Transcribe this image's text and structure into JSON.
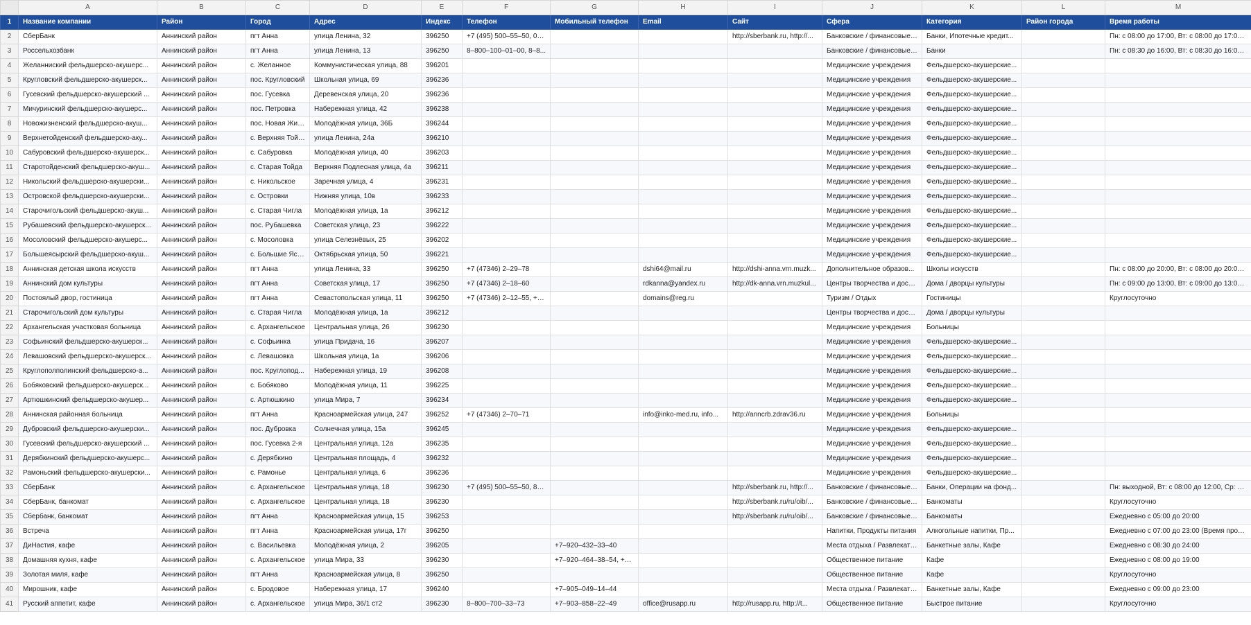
{
  "columns": [
    "A",
    "B",
    "C",
    "D",
    "E",
    "F",
    "G",
    "H",
    "I",
    "J",
    "K",
    "L",
    "M"
  ],
  "header": {
    "row_number": "1",
    "cells": [
      "Название компании",
      "Район",
      "Город",
      "Адрес",
      "Индекс",
      "Телефон",
      "Мобильный телефон",
      "Email",
      "Сайт",
      "Сфера",
      "Категория",
      "Район города",
      "Время работы"
    ]
  },
  "rows": [
    {
      "n": "2",
      "cells": [
        "СберБанк",
        "Аннинский район",
        "пгт Анна",
        "улица Ленина, 32",
        "396250",
        "+7 (495) 500–55–50, 03...",
        "",
        "",
        "http://sberbank.ru, http://...",
        "Банковские / финансовые ...",
        "Банки, Ипотечные кредит...",
        "",
        "Пн: с 08:00 до 17:00, Вт: с 08:00 до 17:00, С..."
      ]
    },
    {
      "n": "3",
      "cells": [
        "Россельхозбанк",
        "Аннинский район",
        "пгт Анна",
        "улица Ленина, 13",
        "396250",
        "8–800–100–01–00, 8–8...",
        "",
        "",
        "",
        "Банковские / финансовые ...",
        "Банки",
        "",
        "Пн: с 08:30 до 16:00, Вт: с 08:30 до 16:00, С..."
      ]
    },
    {
      "n": "4",
      "cells": [
        "Желанниский фельдшерско-акушерс...",
        "Аннинский район",
        "с. Желанное",
        "Коммунистическая улица, 88",
        "396201",
        "",
        "",
        "",
        "",
        "Медицинские учреждения",
        "Фельдшерско-акушерские...",
        "",
        ""
      ]
    },
    {
      "n": "5",
      "cells": [
        "Кругловский фельдшерско-акушерск...",
        "Аннинский район",
        "пос. Кругловский",
        "Школьная улица, 69",
        "396236",
        "",
        "",
        "",
        "",
        "Медицинские учреждения",
        "Фельдшерско-акушерские...",
        "",
        ""
      ]
    },
    {
      "n": "6",
      "cells": [
        "Гусевский фельдшерско-акушерский ...",
        "Аннинский район",
        "пос. Гусевка",
        "Деревенская улица, 20",
        "396236",
        "",
        "",
        "",
        "",
        "Медицинские учреждения",
        "Фельдшерско-акушерские...",
        "",
        ""
      ]
    },
    {
      "n": "7",
      "cells": [
        "Мичуринский фельдшерско-акушерс...",
        "Аннинский район",
        "пос. Петровка",
        "Набережная улица, 42",
        "396238",
        "",
        "",
        "",
        "",
        "Медицинские учреждения",
        "Фельдшерско-акушерские...",
        "",
        ""
      ]
    },
    {
      "n": "8",
      "cells": [
        "Новожизненский фельдшерско-акуш...",
        "Аннинский район",
        "пос. Новая Жиз...",
        "Молодёжная улица, 36Б",
        "396244",
        "",
        "",
        "",
        "",
        "Медицинские учреждения",
        "Фельдшерско-акушерские...",
        "",
        ""
      ]
    },
    {
      "n": "9",
      "cells": [
        "Верхнетойденский фельдшерско-аку...",
        "Аннинский район",
        "с. Верхняя Тойда",
        "улица Ленина, 24а",
        "396210",
        "",
        "",
        "",
        "",
        "Медицинские учреждения",
        "Фельдшерско-акушерские...",
        "",
        ""
      ]
    },
    {
      "n": "10",
      "cells": [
        "Сабуровский фельдшерско-акушерск...",
        "Аннинский район",
        "с. Сабуровка",
        "Молодёжная улица, 40",
        "396203",
        "",
        "",
        "",
        "",
        "Медицинские учреждения",
        "Фельдшерско-акушерские...",
        "",
        ""
      ]
    },
    {
      "n": "11",
      "cells": [
        "Старотойденский фельдшерско-акуш...",
        "Аннинский район",
        "с. Старая Тойда",
        "Верхняя Подлесная улица, 4а",
        "396211",
        "",
        "",
        "",
        "",
        "Медицинские учреждения",
        "Фельдшерско-акушерские...",
        "",
        ""
      ]
    },
    {
      "n": "12",
      "cells": [
        "Никольский фельдшерско-акушерски...",
        "Аннинский район",
        "с. Никольское",
        "Заречная улица, 4",
        "396231",
        "",
        "",
        "",
        "",
        "Медицинские учреждения",
        "Фельдшерско-акушерские...",
        "",
        ""
      ]
    },
    {
      "n": "13",
      "cells": [
        "Островской фельдшерско-акушерски...",
        "Аннинский район",
        "с. Островки",
        "Нижняя улица, 10в",
        "396233",
        "",
        "",
        "",
        "",
        "Медицинские учреждения",
        "Фельдшерско-акушерские...",
        "",
        ""
      ]
    },
    {
      "n": "14",
      "cells": [
        "Старочигольский фельдшерско-акуш...",
        "Аннинский район",
        "с. Старая Чигла",
        "Молодёжная улица, 1а",
        "396212",
        "",
        "",
        "",
        "",
        "Медицинские учреждения",
        "Фельдшерско-акушерские...",
        "",
        ""
      ]
    },
    {
      "n": "15",
      "cells": [
        "Рубашевский фельдшерско-акушерск...",
        "Аннинский район",
        "пос. Рубашевка",
        "Советская улица, 23",
        "396222",
        "",
        "",
        "",
        "",
        "Медицинские учреждения",
        "Фельдшерско-акушерские...",
        "",
        ""
      ]
    },
    {
      "n": "16",
      "cells": [
        "Мосоловский фельдшерско-акушерс...",
        "Аннинский район",
        "с. Мосоловка",
        "улица Селезнёвых, 25",
        "396202",
        "",
        "",
        "",
        "",
        "Медицинские учреждения",
        "Фельдшерско-акушерские...",
        "",
        ""
      ]
    },
    {
      "n": "17",
      "cells": [
        "Большеясырский фельдшерско-акуш...",
        "Аннинский район",
        "с. Большие Ясы...",
        "Октябрьская улица, 50",
        "396221",
        "",
        "",
        "",
        "",
        "Медицинские учреждения",
        "Фельдшерско-акушерские...",
        "",
        ""
      ]
    },
    {
      "n": "18",
      "cells": [
        "Аннинская детская школа искусств",
        "Аннинский район",
        "пгт Анна",
        "улица Ленина, 33",
        "396250",
        "+7 (47346) 2–29–78",
        "",
        "dshi64@mail.ru",
        "http://dshi-anna.vrn.muzk...",
        "Дополнительное образов...",
        "Школы искусств",
        "",
        "Пн: с 08:00 до 20:00, Вт: с 08:00 до 20:00, С..."
      ]
    },
    {
      "n": "19",
      "cells": [
        "Аннинский дом культуры",
        "Аннинский район",
        "пгт Анна",
        "Советская улица, 17",
        "396250",
        "+7 (47346) 2–18–60",
        "",
        "rdkanna@yandex.ru",
        "http://dk-anna.vrn.muzkul...",
        "Центры творчества и досуга",
        "Дома / дворцы культуры",
        "",
        "Пн: с 09:00 до 13:00, Вт: с 09:00 до 13:00, С..."
      ]
    },
    {
      "n": "20",
      "cells": [
        "Постоялый двор, гостиница",
        "Аннинский район",
        "пгт Анна",
        "Севастопольская улица, 11",
        "396250",
        "+7 (47346) 2–12–55, +7...",
        "",
        "domains@reg.ru",
        "",
        "Туризм / Отдых",
        "Гостиницы",
        "",
        "Круглосуточно"
      ]
    },
    {
      "n": "21",
      "cells": [
        "Старочигольский дом культуры",
        "Аннинский район",
        "с. Старая Чигла",
        "Молодёжная улица, 1а",
        "396212",
        "",
        "",
        "",
        "",
        "Центры творчества и досуга",
        "Дома / дворцы культуры",
        "",
        ""
      ]
    },
    {
      "n": "22",
      "cells": [
        "Архангельская участковая больница",
        "Аннинский район",
        "с. Архангельское",
        "Центральная улица, 26",
        "396230",
        "",
        "",
        "",
        "",
        "Медицинские учреждения",
        "Больницы",
        "",
        ""
      ]
    },
    {
      "n": "23",
      "cells": [
        "Софьинский фельдшерско-акушерск...",
        "Аннинский район",
        "с. Софьинка",
        "улица Придача, 16",
        "396207",
        "",
        "",
        "",
        "",
        "Медицинские учреждения",
        "Фельдшерско-акушерские...",
        "",
        ""
      ]
    },
    {
      "n": "24",
      "cells": [
        "Левашовский фельдшерско-акушерск...",
        "Аннинский район",
        "с. Левашовка",
        "Школьная улица, 1а",
        "396206",
        "",
        "",
        "",
        "",
        "Медицинские учреждения",
        "Фельдшерско-акушерские...",
        "",
        ""
      ]
    },
    {
      "n": "25",
      "cells": [
        "Круглополполинский фельдшерско-а...",
        "Аннинский район",
        "пос. Круглопод...",
        "Набережная улица, 19",
        "396208",
        "",
        "",
        "",
        "",
        "Медицинские учреждения",
        "Фельдшерско-акушерские...",
        "",
        ""
      ]
    },
    {
      "n": "26",
      "cells": [
        "Бобяковский фельдшерско-акушерск...",
        "Аннинский район",
        "с. Бобяково",
        "Молодёжная улица, 11",
        "396225",
        "",
        "",
        "",
        "",
        "Медицинские учреждения",
        "Фельдшерско-акушерские...",
        "",
        ""
      ]
    },
    {
      "n": "27",
      "cells": [
        "Артюшкинский фельдшерско-акушер...",
        "Аннинский район",
        "с. Артюшкино",
        "улица Мира, 7",
        "396234",
        "",
        "",
        "",
        "",
        "Медицинские учреждения",
        "Фельдшерско-акушерские...",
        "",
        ""
      ]
    },
    {
      "n": "28",
      "cells": [
        "Аннинская районная больница",
        "Аннинский район",
        "пгт Анна",
        "Красноармейская улица, 247",
        "396252",
        "+7 (47346) 2–70–71",
        "",
        "info@inko-med.ru, info...",
        "http://anncrb.zdrav36.ru",
        "Медицинские учреждения",
        "Больницы",
        "",
        ""
      ]
    },
    {
      "n": "29",
      "cells": [
        "Дубровский фельдшерско-акушерски...",
        "Аннинский район",
        "пос. Дубровка",
        "Солнечная улица, 15а",
        "396245",
        "",
        "",
        "",
        "",
        "Медицинские учреждения",
        "Фельдшерско-акушерские...",
        "",
        ""
      ]
    },
    {
      "n": "30",
      "cells": [
        "Гусевский фельдшерско-акушерский ...",
        "Аннинский район",
        "пос. Гусевка 2-я",
        "Центральная улица, 12а",
        "396235",
        "",
        "",
        "",
        "",
        "Медицинские учреждения",
        "Фельдшерско-акушерские...",
        "",
        ""
      ]
    },
    {
      "n": "31",
      "cells": [
        "Дерябкинский фельдшерско-акушерс...",
        "Аннинский район",
        "с. Дерябкино",
        "Центральная площадь, 4",
        "396232",
        "",
        "",
        "",
        "",
        "Медицинские учреждения",
        "Фельдшерско-акушерские...",
        "",
        ""
      ]
    },
    {
      "n": "32",
      "cells": [
        "Рамоньский фельдшерско-акушерски...",
        "Аннинский район",
        "с. Рамонье",
        "Центральная улица, 6",
        "396236",
        "",
        "",
        "",
        "",
        "Медицинские учреждения",
        "Фельдшерско-акушерские...",
        "",
        ""
      ]
    },
    {
      "n": "33",
      "cells": [
        "СберБанк",
        "Аннинский район",
        "с. Архангельское",
        "Центральная улица, 18",
        "396230",
        "+7 (495) 500–55–50, 8–...",
        "",
        "",
        "http://sberbank.ru, http://...",
        "Банковские / финансовые ...",
        "Банки, Операции на фонд...",
        "",
        "Пн: выходной, Вт: с 08:00 до 12:00, Ср: с 0..."
      ]
    },
    {
      "n": "34",
      "cells": [
        "СберБанк, банкомат",
        "Аннинский район",
        "с. Архангельское",
        "Центральная улица, 18",
        "396230",
        "",
        "",
        "",
        "http://sberbank.ru/ru/oib/...",
        "Банковские / финансовые ...",
        "Банкоматы",
        "",
        "Круглосуточно"
      ]
    },
    {
      "n": "35",
      "cells": [
        "Сбербанк, банкомат",
        "Аннинский район",
        "пгт Анна",
        "Красноармейская улица, 15",
        "396253",
        "",
        "",
        "",
        "http://sberbank.ru/ru/oib/...",
        "Банковские / финансовые ...",
        "Банкоматы",
        "",
        "Ежедневно с 05:00 до 20:00"
      ]
    },
    {
      "n": "36",
      "cells": [
        "Встреча",
        "Аннинский район",
        "пгт Анна",
        "Красноармейская улица, 17г",
        "396250",
        "",
        "",
        "",
        "",
        "Напитки, Продукты питания",
        "Алкогольные напитки, Пр...",
        "",
        "Ежедневно с 07:00 до 23:00 (Время прода..."
      ]
    },
    {
      "n": "37",
      "cells": [
        "ДиНастия, кафе",
        "Аннинский район",
        "с. Васильевка",
        "Молодёжная улица, 2",
        "396205",
        "",
        "+7–920–432–33–40",
        "",
        "",
        "Места отдыха / Развлекате...",
        "Банкетные залы, Кафе",
        "",
        "Ежедневно с 08:30 до 24:00"
      ]
    },
    {
      "n": "38",
      "cells": [
        "Домашняя кухня, кафе",
        "Аннинский район",
        "с. Архангельское",
        "улица Мира, 33",
        "396230",
        "",
        "+7–920–464–38–54, +7...",
        "",
        "",
        "Общественное питание",
        "Кафе",
        "",
        "Ежедневно с 08:00 до 19:00"
      ]
    },
    {
      "n": "39",
      "cells": [
        "Золотая миля, кафе",
        "Аннинский район",
        "пгт Анна",
        "Красноармейская улица, 8",
        "396250",
        "",
        "",
        "",
        "",
        "Общественное питание",
        "Кафе",
        "",
        "Круглосуточно"
      ]
    },
    {
      "n": "40",
      "cells": [
        "Мирошник, кафе",
        "Аннинский район",
        "с. Бродовое",
        "Набережная улица, 17",
        "396240",
        "",
        "+7–905–049–14–44",
        "",
        "",
        "Места отдыха / Развлекате...",
        "Банкетные залы, Кафе",
        "",
        "Ежедневно с 09:00 до 23:00"
      ]
    },
    {
      "n": "41",
      "cells": [
        "Русский аппетит, кафе",
        "Аннинский район",
        "с. Архангельское",
        "улица Мира, 36/1 ст2",
        "396230",
        "8–800–700–33–73",
        "+7–903–858–22–49",
        "office@rusapp.ru",
        "http://rusapp.ru, http://t...",
        "Общественное питание",
        "Быстрое питание",
        "",
        "Круглосуточно"
      ]
    }
  ],
  "colors": {
    "header_bg": "#1f4e9c",
    "header_text": "#ffffff",
    "stripe": "#f6f8fc",
    "gridline": "#e0e0e0"
  }
}
